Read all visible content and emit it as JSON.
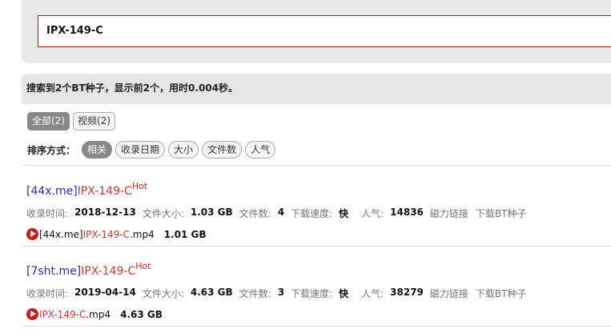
{
  "search": {
    "value": "IPX-149-C"
  },
  "summary": "搜索到2个BT种子，显示前2个，用时0.004秒。",
  "filters": [
    {
      "label": "全部(2)"
    },
    {
      "label": "视频(2)"
    }
  ],
  "sort": {
    "label": "排序方式：",
    "options": [
      {
        "label": "相关"
      },
      {
        "label": "收录日期"
      },
      {
        "label": "大小"
      },
      {
        "label": "文件数"
      },
      {
        "label": "人气"
      }
    ]
  },
  "labels": {
    "indexed": "收录时间:",
    "size": "文件大小:",
    "files": "文件数:",
    "speed": "下载速度:",
    "popularity": "人气:",
    "magnet": "磁力链接",
    "torrent": "下载BT种子",
    "hot": "Hot"
  },
  "results": [
    {
      "site": "[44x.me]",
      "keyword": "IPX-149-C",
      "date": "2018-12-13",
      "size": "1.03 GB",
      "files": "4",
      "speed": "快",
      "popularity": "14836",
      "file": {
        "prefix": "[44x.me]",
        "keyword": "IPX-149-C",
        "ext": ".mp4",
        "size": "1.01 GB"
      }
    },
    {
      "site": "[7sht.me]",
      "keyword": "IPX-149-C",
      "date": "2019-04-14",
      "size": "4.63 GB",
      "files": "3",
      "speed": "快",
      "popularity": "38279",
      "file": {
        "prefix": "",
        "keyword": "IPX-149-C",
        "ext": ".mp4",
        "size": "4.63 GB"
      }
    }
  ],
  "colors": {
    "accent": "#c93a2f",
    "link": "#2c2cb0",
    "play": "#c71c1c"
  }
}
